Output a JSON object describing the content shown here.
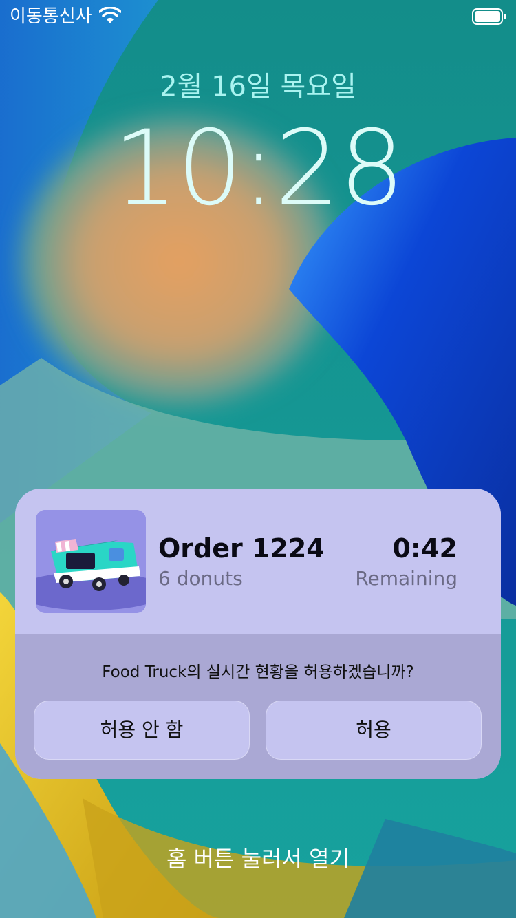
{
  "status_bar": {
    "carrier": "이동통신사",
    "wifi_icon": "wifi-icon",
    "battery_icon": "battery-icon"
  },
  "lock_screen": {
    "date": "2월 16일 목요일",
    "time": "10:28",
    "home_hint": "홈 버튼 눌러서 열기"
  },
  "live_activity": {
    "app_icon": "food-truck-icon",
    "order_title": "Order 1224",
    "order_subtitle": "6 donuts",
    "timer": "0:42",
    "timer_label": "Remaining"
  },
  "permission_prompt": {
    "question": "Food Truck의 실시간 현황을 허용하겠습니까?",
    "deny_label": "허용 안 함",
    "allow_label": "허용"
  },
  "colors": {
    "card_top": "#c5c4f0",
    "card_bottom": "#aaa8d4",
    "date_text": "#a9f3f0",
    "clock_text": "#dcfbf8",
    "secondary_text": "#6b6a85"
  }
}
